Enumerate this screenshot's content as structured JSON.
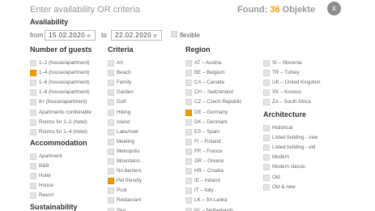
{
  "header": {
    "title": "Enter availability OR criteria",
    "found_prefix": "Found:",
    "found_count": "36",
    "found_suffix": "Objekte",
    "close_label": "x"
  },
  "availability": {
    "label": "Availability",
    "from_label": "from",
    "from_date": "15.02.2020",
    "to_label": "to",
    "to_date": "22.02.2020",
    "flexible_label": "flexible",
    "calendar_icon": "calendar-icon"
  },
  "guests": {
    "title": "Number of guests",
    "items": [
      {
        "label": "1–2 (house/apartment)",
        "checked": false
      },
      {
        "label": "1–4 (house/apartment)",
        "checked": true
      },
      {
        "label": "1–6 (house/apartment)",
        "checked": false
      },
      {
        "label": "1–8 (house/apartment)",
        "checked": false
      },
      {
        "label": "8+ (house/apartment)",
        "checked": false
      },
      {
        "label": "Apartments combinable",
        "checked": false
      },
      {
        "label": "Rooms for 1–2 (hotel)",
        "checked": false
      },
      {
        "label": "Rooms for 1–4 (hotel)",
        "checked": false
      }
    ]
  },
  "accommodation": {
    "title": "Accommodation",
    "items": [
      {
        "label": "Apartment",
        "checked": false
      },
      {
        "label": "B&B",
        "checked": false
      },
      {
        "label": "Hotel",
        "checked": false
      },
      {
        "label": "House",
        "checked": false
      },
      {
        "label": "Resort",
        "checked": false
      }
    ]
  },
  "sustainability": {
    "title": "Sustainability"
  },
  "criteria": {
    "title": "Criteria",
    "items": [
      {
        "label": "Art",
        "checked": false
      },
      {
        "label": "Beach",
        "checked": false
      },
      {
        "label": "Family",
        "checked": false
      },
      {
        "label": "Garden",
        "checked": false
      },
      {
        "label": "Golf",
        "checked": false
      },
      {
        "label": "Hiking",
        "checked": false
      },
      {
        "label": "Island",
        "checked": false
      },
      {
        "label": "Lake/river",
        "checked": false
      },
      {
        "label": "Meeting",
        "checked": false
      },
      {
        "label": "Metropolis",
        "checked": false
      },
      {
        "label": "Mountains",
        "checked": false
      },
      {
        "label": "No barriers",
        "checked": false
      },
      {
        "label": "Pet friendly",
        "checked": true
      },
      {
        "label": "Pool",
        "checked": false
      },
      {
        "label": "Restaurant",
        "checked": false
      },
      {
        "label": "Sea",
        "checked": false
      }
    ]
  },
  "region": {
    "title": "Region",
    "col1": [
      {
        "label": "AT – Austria",
        "checked": false
      },
      {
        "label": "BE – Belgium",
        "checked": false
      },
      {
        "label": "CA – Canada",
        "checked": false
      },
      {
        "label": "CH – Switzerland",
        "checked": false
      },
      {
        "label": "CZ – Czech Republic",
        "checked": false
      },
      {
        "label": "DE – Germany",
        "checked": true
      },
      {
        "label": "DK – Denmark",
        "checked": false
      },
      {
        "label": "ES – Spain",
        "checked": false
      },
      {
        "label": "FI – Finland",
        "checked": false
      },
      {
        "label": "FR – France",
        "checked": false
      },
      {
        "label": "GR – Greece",
        "checked": false
      },
      {
        "label": "HR – Croatia",
        "checked": false
      },
      {
        "label": "IE – Ireland",
        "checked": false
      },
      {
        "label": "IT – Italy",
        "checked": false
      },
      {
        "label": "LK – Sri Lanka",
        "checked": false
      },
      {
        "label": "NL – Netherlands",
        "checked": false
      }
    ],
    "col2": [
      {
        "label": "SI – Slovenia",
        "checked": false
      },
      {
        "label": "TR – Turkey",
        "checked": false
      },
      {
        "label": "UK – United Kingdom",
        "checked": false
      },
      {
        "label": "XK – Kosovo",
        "checked": false
      },
      {
        "label": "ZA – South Africa",
        "checked": false
      }
    ]
  },
  "architecture": {
    "title": "Architecture",
    "items": [
      {
        "label": "Historical",
        "checked": false
      },
      {
        "label": "Listed building - new",
        "checked": false
      },
      {
        "label": "Listed building - old",
        "checked": false
      },
      {
        "label": "Modern",
        "checked": false
      },
      {
        "label": "Modern classic",
        "checked": false
      },
      {
        "label": "Old",
        "checked": false
      },
      {
        "label": "Old & new",
        "checked": false
      }
    ]
  },
  "colors": {
    "accent": "#f29a00",
    "checkbox": "#e3e3e3",
    "close_button": "#8d8d8d"
  }
}
